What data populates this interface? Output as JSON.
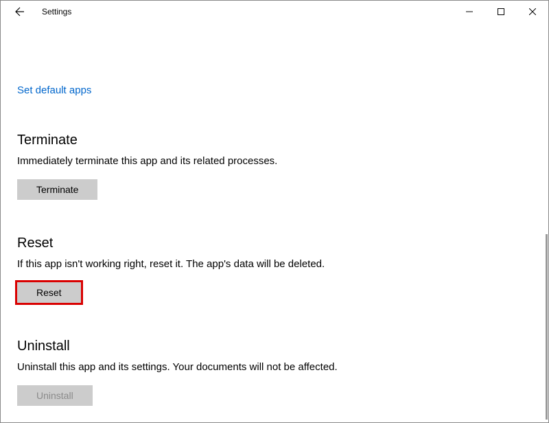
{
  "window": {
    "title": "Settings"
  },
  "link": {
    "set_default_apps": "Set default apps"
  },
  "terminate": {
    "heading": "Terminate",
    "description": "Immediately terminate this app and its related processes.",
    "button_label": "Terminate"
  },
  "reset": {
    "heading": "Reset",
    "description": "If this app isn't working right, reset it. The app's data will be deleted.",
    "button_label": "Reset"
  },
  "uninstall": {
    "heading": "Uninstall",
    "description": "Uninstall this app and its settings. Your documents will not be affected.",
    "button_label": "Uninstall"
  }
}
